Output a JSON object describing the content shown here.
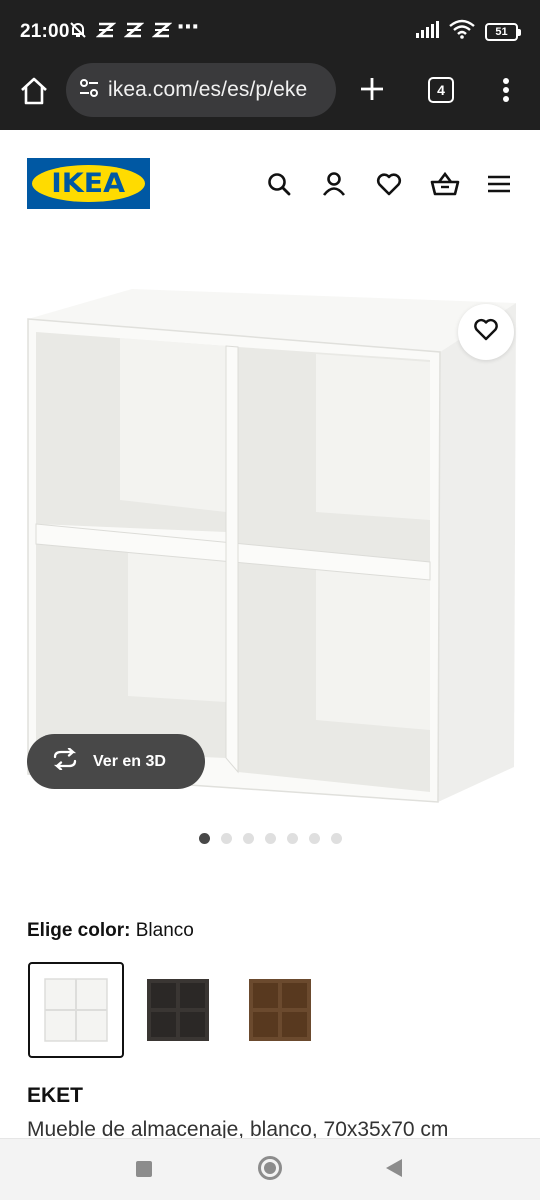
{
  "status_bar": {
    "time": "21:00",
    "extra_indicator": "⋯",
    "battery": "51",
    "icons": [
      "mute-icon",
      "notification-icon",
      "notification-icon",
      "notification-icon",
      "signal-icon",
      "wifi-icon",
      "battery-icon"
    ]
  },
  "browser": {
    "url": "ikea.com/es/es/p/eke",
    "tab_count": "4",
    "icons": [
      "home-icon",
      "site-settings-icon",
      "new-tab-icon",
      "tabs-icon",
      "more-vert-icon"
    ]
  },
  "header": {
    "logo_text": "IKEA",
    "colors": {
      "logo_blue": "#0058a3",
      "logo_yellow": "#ffdb00"
    },
    "icons": [
      "search-icon",
      "account-icon",
      "wishlist-icon",
      "cart-icon",
      "menu-icon"
    ]
  },
  "gallery": {
    "ver_3d_label": "Ver en 3D",
    "image_count": 7,
    "active_index": 0
  },
  "color_picker": {
    "label": "Elige color:",
    "selected_value": "Blanco",
    "swatches": [
      {
        "name": "white",
        "color": "#f4f4f2",
        "selected": true
      },
      {
        "name": "dark-gray",
        "color": "#3a3633",
        "selected": false
      },
      {
        "name": "walnut",
        "color": "#6b4a2e",
        "selected": false
      }
    ]
  },
  "product": {
    "name": "EKET",
    "description": "Mueble de almacenaje, blanco, 70x35x70 cm"
  }
}
